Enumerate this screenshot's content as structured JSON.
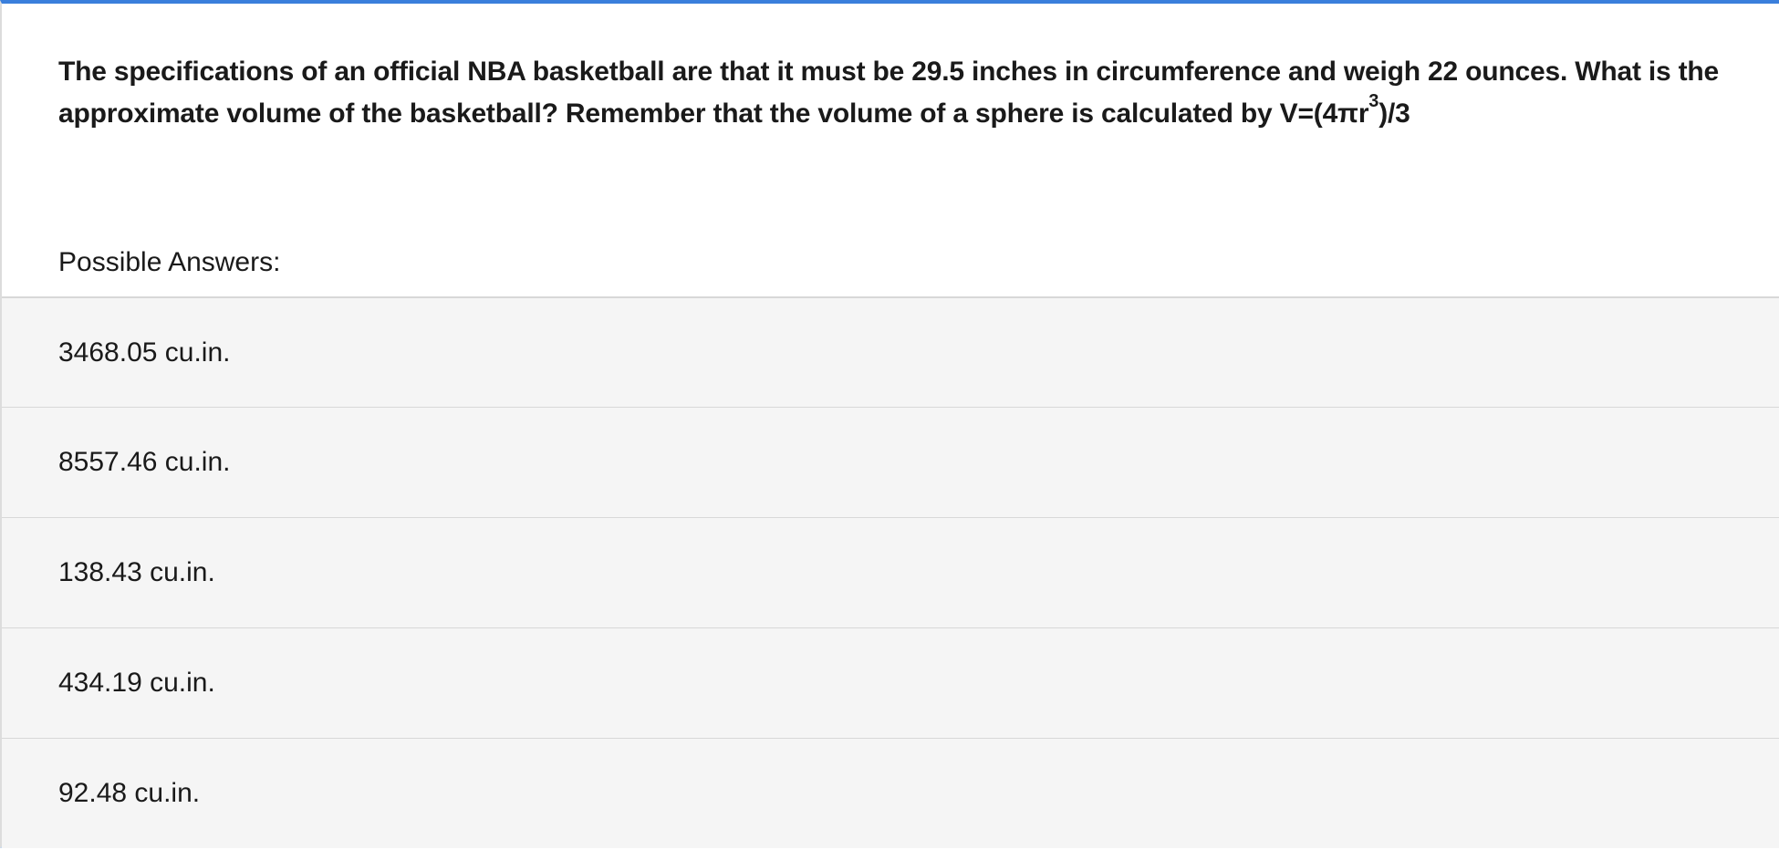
{
  "question": {
    "text_before_exponent": "The specifications of an official NBA basketball are that it must be 29.5 inches in circumference and weigh 22 ounces.  What is the approximate volume of the basketball?   Remember that the volume of a sphere is calculated by V=(4πr",
    "exponent": "3",
    "text_after_exponent": ")/3"
  },
  "answers_label": "Possible Answers:",
  "answers": [
    {
      "label": "3468.05 cu.in."
    },
    {
      "label": "8557.46 cu.in."
    },
    {
      "label": "138.43 cu.in."
    },
    {
      "label": "434.19 cu.in."
    },
    {
      "label": "92.48 cu.in."
    }
  ],
  "colors": {
    "accent": "#3a7fdc",
    "answer_background": "#f5f5f5"
  }
}
